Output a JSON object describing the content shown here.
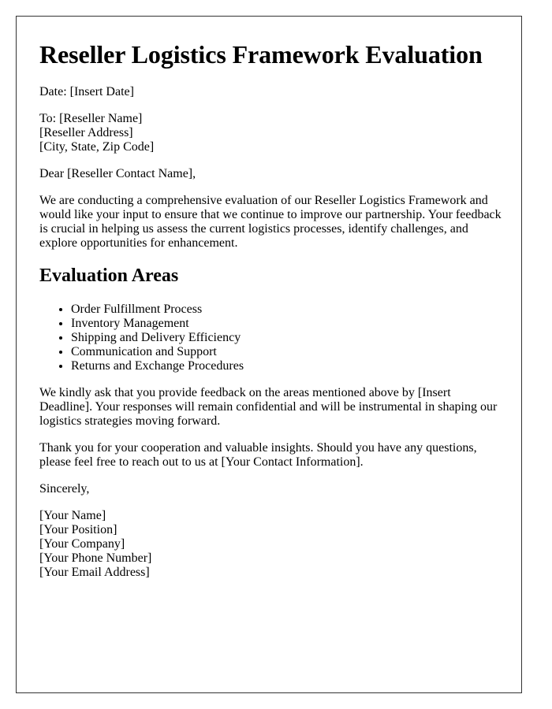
{
  "title": "Reseller Logistics Framework Evaluation",
  "date_line": "Date: [Insert Date]",
  "recipient": {
    "to": "To: [Reseller Name]",
    "address": "[Reseller Address]",
    "city": "[City, State, Zip Code]"
  },
  "salutation": "Dear [Reseller Contact Name],",
  "intro": "We are conducting a comprehensive evaluation of our Reseller Logistics Framework and would like your input to ensure that we continue to improve our partnership. Your feedback is crucial in helping us assess the current logistics processes, identify challenges, and explore opportunities for enhancement.",
  "section_heading": "Evaluation Areas",
  "evaluation_areas": [
    "Order Fulfillment Process",
    "Inventory Management",
    "Shipping and Delivery Efficiency",
    "Communication and Support",
    "Returns and Exchange Procedures"
  ],
  "request_paragraph": "We kindly ask that you provide feedback on the areas mentioned above by [Insert Deadline]. Your responses will remain confidential and will be instrumental in shaping our logistics strategies moving forward.",
  "thanks_paragraph": "Thank you for your cooperation and valuable insights. Should you have any questions, please feel free to reach out to us at [Your Contact Information].",
  "closing": "Sincerely,",
  "signature": {
    "name": "[Your Name]",
    "position": "[Your Position]",
    "company": "[Your Company]",
    "phone": "[Your Phone Number]",
    "email": "[Your Email Address]"
  }
}
